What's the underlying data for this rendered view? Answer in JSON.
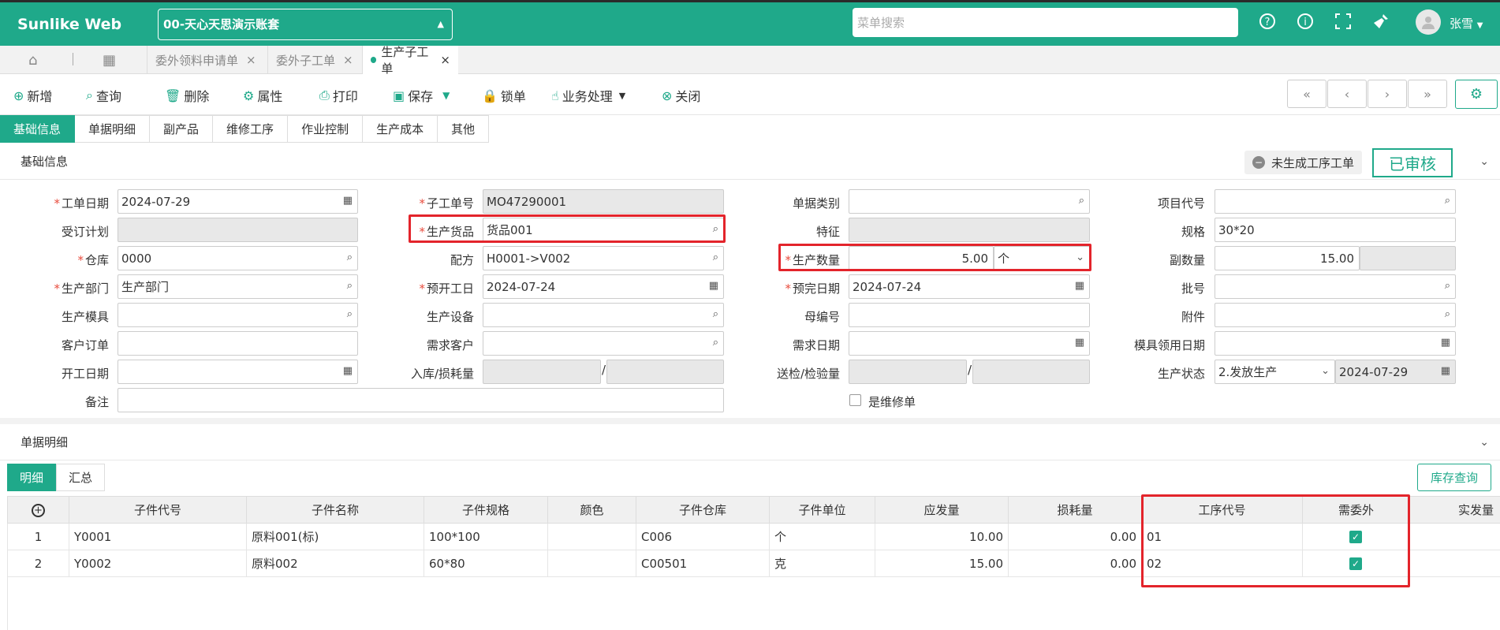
{
  "app": {
    "logo": "Sunlike Web",
    "account": "00-天心天思演示账套",
    "search_placeholder": "菜单搜索",
    "user": "张雪"
  },
  "doc_tabs": [
    {
      "label": "委外领料申请单"
    },
    {
      "label": "委外子工单"
    },
    {
      "label": "生产子工单"
    }
  ],
  "toolbar": {
    "new": "新增",
    "query": "查询",
    "delete": "删除",
    "props": "属性",
    "print": "打印",
    "save": "保存",
    "lock": "锁单",
    "business": "业务处理",
    "close": "关闭"
  },
  "form_tabs": [
    "基础信息",
    "单据明细",
    "副产品",
    "维修工序",
    "作业控制",
    "生产成本",
    "其他"
  ],
  "section_basic": {
    "title": "基础信息",
    "pending": "未生成工序工单",
    "approved": "已审核"
  },
  "fields": {
    "work_date": {
      "label": "工单日期",
      "value": "2024-07-29"
    },
    "sub_no": {
      "label": "子工单号",
      "value": "MO47290001"
    },
    "doc_type": {
      "label": "单据类别",
      "value": ""
    },
    "project": {
      "label": "项目代号",
      "value": ""
    },
    "order_plan": {
      "label": "受订计划",
      "value": ""
    },
    "product": {
      "label": "生产货品",
      "value": "货品001"
    },
    "feature": {
      "label": "特征",
      "value": ""
    },
    "spec": {
      "label": "规格",
      "value": "30*20"
    },
    "warehouse": {
      "label": "仓库",
      "value": "0000"
    },
    "formula": {
      "label": "配方",
      "value": "H0001->V002"
    },
    "qty": {
      "label": "生产数量",
      "value": "5.00",
      "unit": "个"
    },
    "sub_qty": {
      "label": "副数量",
      "value": "15.00"
    },
    "dept": {
      "label": "生产部门",
      "value": "生产部门"
    },
    "start_date": {
      "label": "预开工日",
      "value": "2024-07-24"
    },
    "finish_date": {
      "label": "预完日期",
      "value": "2024-07-24"
    },
    "batch": {
      "label": "批号",
      "value": ""
    },
    "mold": {
      "label": "生产模具",
      "value": ""
    },
    "equipment": {
      "label": "生产设备",
      "value": ""
    },
    "parent_no": {
      "label": "母编号",
      "value": ""
    },
    "attachment": {
      "label": "附件",
      "value": ""
    },
    "cust_order": {
      "label": "客户订单",
      "value": ""
    },
    "demand_cust": {
      "label": "需求客户",
      "value": ""
    },
    "demand_date": {
      "label": "需求日期",
      "value": ""
    },
    "mold_date": {
      "label": "模具领用日期",
      "value": ""
    },
    "open_date": {
      "label": "开工日期",
      "value": ""
    },
    "in_loss": {
      "label": "入库/损耗量",
      "value": ""
    },
    "inspect": {
      "label": "送检/检验量",
      "value": ""
    },
    "status": {
      "label": "生产状态",
      "value": "2.发放生产",
      "date": "2024-07-29"
    },
    "remark": {
      "label": "备注",
      "value": ""
    },
    "repair": {
      "label": "是维修单"
    }
  },
  "section_detail": {
    "title": "单据明细",
    "tab_detail": "明细",
    "tab_summary": "汇总",
    "stock_btn": "库存查询"
  },
  "table": {
    "headers": [
      "子件代号",
      "子件名称",
      "子件规格",
      "颜色",
      "子件仓库",
      "子件单位",
      "应发量",
      "损耗量",
      "工序代号",
      "需委外",
      "实发量"
    ],
    "rows": [
      {
        "no": "1",
        "code": "Y0001",
        "name": "原料001(标)",
        "spec": "100*100",
        "color": "",
        "wh": "C006",
        "unit": "个",
        "qty": "10.00",
        "loss": "0.00",
        "proc": "01",
        "outsource": true,
        "actual": ""
      },
      {
        "no": "2",
        "code": "Y0002",
        "name": "原料002",
        "spec": "60*80",
        "color": "",
        "wh": "C00501",
        "unit": "克",
        "qty": "15.00",
        "loss": "0.00",
        "proc": "02",
        "outsource": true,
        "actual": ""
      }
    ]
  },
  "colors": {
    "accent": "#1fa98a",
    "highlight": "#e3242b"
  }
}
